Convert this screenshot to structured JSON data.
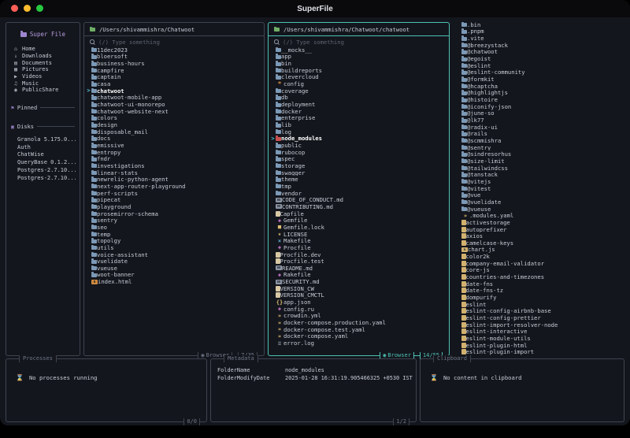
{
  "titlebar": {
    "title": "SuperFile"
  },
  "sidebar": {
    "app_title": "Super File",
    "nav": [
      {
        "label": "Home",
        "icon": "home"
      },
      {
        "label": "Downloads",
        "icon": "downloads"
      },
      {
        "label": "Documents",
        "icon": "documents"
      },
      {
        "label": "Pictures",
        "icon": "pictures"
      },
      {
        "label": "Videos",
        "icon": "videos"
      },
      {
        "label": "Music",
        "icon": "music"
      },
      {
        "label": "PublicShare",
        "icon": "publicshare"
      }
    ],
    "pinned_label": "Pinned",
    "disks_label": "Disks",
    "disks": [
      "Granola 5.175.0...",
      "Auth",
      "ChatWise",
      "QueryBase 0.1.2...",
      "Postgres-2.7.10...",
      "Postgres-2.7.10..."
    ]
  },
  "panels": [
    {
      "path": "/Users/shivammishra/Chatwoot",
      "search_placeholder": "(/) Type something",
      "mode": "Browser",
      "count": "7/35",
      "files": [
        {
          "name": "11dec2023",
          "icon": "folder"
        },
        {
          "name": "bloersoft",
          "icon": "folder"
        },
        {
          "name": "business-hours",
          "icon": "folder"
        },
        {
          "name": "campfire",
          "icon": "folder"
        },
        {
          "name": "captain",
          "icon": "folder"
        },
        {
          "name": "casa",
          "icon": "folder"
        },
        {
          "name": "chatwoot",
          "icon": "folder",
          "sel": true
        },
        {
          "name": "chatwoot-mobile-app",
          "icon": "folder"
        },
        {
          "name": "chatwoot-ui-monorepo",
          "icon": "folder"
        },
        {
          "name": "chatwoot-website-next",
          "icon": "folder"
        },
        {
          "name": "colors",
          "icon": "folder"
        },
        {
          "name": "design",
          "icon": "folder"
        },
        {
          "name": "disposable_mail",
          "icon": "folder"
        },
        {
          "name": "docs",
          "icon": "folder"
        },
        {
          "name": "emissive",
          "icon": "folder"
        },
        {
          "name": "entropy",
          "icon": "folder"
        },
        {
          "name": "fndr",
          "icon": "folder"
        },
        {
          "name": "investigations",
          "icon": "folder"
        },
        {
          "name": "linear-stats",
          "icon": "folder"
        },
        {
          "name": "newrelic-python-agent",
          "icon": "folder"
        },
        {
          "name": "next-app-router-playground",
          "icon": "folder"
        },
        {
          "name": "perf-scripts",
          "icon": "folder"
        },
        {
          "name": "pipecat",
          "icon": "folder"
        },
        {
          "name": "playground",
          "icon": "folder"
        },
        {
          "name": "prosemirror-schema",
          "icon": "folder"
        },
        {
          "name": "sentry",
          "icon": "folder"
        },
        {
          "name": "seo",
          "icon": "folder"
        },
        {
          "name": "temp",
          "icon": "folder"
        },
        {
          "name": "topolgy",
          "icon": "folder"
        },
        {
          "name": "utils",
          "icon": "folder"
        },
        {
          "name": "voice-assistant",
          "icon": "folder"
        },
        {
          "name": "vuelidate",
          "icon": "folder"
        },
        {
          "name": "vueuse",
          "icon": "folder"
        },
        {
          "name": "woot-banner",
          "icon": "folder"
        },
        {
          "name": "index.html",
          "icon": "html"
        }
      ]
    },
    {
      "path": "/Users/shivammishra/Chatwoot/chatwoot",
      "search_placeholder": "(/) Type something",
      "mode": "Browser",
      "count": "14/55",
      "files": [
        {
          "name": "__mocks__",
          "icon": "folder"
        },
        {
          "name": "app",
          "icon": "folder"
        },
        {
          "name": "bin",
          "icon": "folder"
        },
        {
          "name": "buildreports",
          "icon": "folder"
        },
        {
          "name": "clevercloud",
          "icon": "folder"
        },
        {
          "name": "config",
          "icon": "gear"
        },
        {
          "name": "coverage",
          "icon": "folder"
        },
        {
          "name": "db",
          "icon": "folder"
        },
        {
          "name": "deployment",
          "icon": "folder"
        },
        {
          "name": "docker",
          "icon": "folder"
        },
        {
          "name": "enterprise",
          "icon": "folder"
        },
        {
          "name": "lib",
          "icon": "folder"
        },
        {
          "name": "log",
          "icon": "folder"
        },
        {
          "name": "node_modules",
          "icon": "folder-red",
          "sel": true
        },
        {
          "name": "public",
          "icon": "folder"
        },
        {
          "name": "rubocop",
          "icon": "folder"
        },
        {
          "name": "spec",
          "icon": "folder"
        },
        {
          "name": "storage",
          "icon": "folder"
        },
        {
          "name": "swagger",
          "icon": "folder"
        },
        {
          "name": "theme",
          "icon": "folder"
        },
        {
          "name": "tmp",
          "icon": "folder"
        },
        {
          "name": "vendor",
          "icon": "folder"
        },
        {
          "name": "CODE_OF_CONDUCT.md",
          "icon": "md"
        },
        {
          "name": "CONTRIBUTING.md",
          "icon": "md"
        },
        {
          "name": "Capfile",
          "icon": "file"
        },
        {
          "name": "Gemfile",
          "icon": "gem"
        },
        {
          "name": "Gemfile.lock",
          "icon": "lock"
        },
        {
          "name": "LICENSE",
          "icon": "key"
        },
        {
          "name": "Makefile",
          "icon": "make"
        },
        {
          "name": "Procfile",
          "icon": "gem"
        },
        {
          "name": "Procfile.dev",
          "icon": "file"
        },
        {
          "name": "Procfile.test",
          "icon": "file"
        },
        {
          "name": "README.md",
          "icon": "md"
        },
        {
          "name": "Rakefile",
          "icon": "gem"
        },
        {
          "name": "SECURITY.md",
          "icon": "md"
        },
        {
          "name": "VERSION_CW",
          "icon": "file"
        },
        {
          "name": "VERSION_CMCTL",
          "icon": "file"
        },
        {
          "name": "app.json",
          "icon": "json"
        },
        {
          "name": "config.ru",
          "icon": "ruby"
        },
        {
          "name": "crowdin.yml",
          "icon": "yaml"
        },
        {
          "name": "docker-compose.production.yaml",
          "icon": "yaml"
        },
        {
          "name": "docker-compose.test.yaml",
          "icon": "yaml"
        },
        {
          "name": "docker-compose.yaml",
          "icon": "yaml"
        },
        {
          "name": "error.log",
          "icon": "log"
        }
      ]
    }
  ],
  "preview": {
    "files": [
      {
        "name": ".bin",
        "icon": "folder"
      },
      {
        "name": ".pnpm",
        "icon": "folder"
      },
      {
        "name": ".vite",
        "icon": "folder"
      },
      {
        "name": "@breezystack",
        "icon": "folder"
      },
      {
        "name": "@chatwoot",
        "icon": "folder"
      },
      {
        "name": "@egoist",
        "icon": "folder"
      },
      {
        "name": "@eslint",
        "icon": "folder"
      },
      {
        "name": "@eslint-community",
        "icon": "folder"
      },
      {
        "name": "@formkit",
        "icon": "folder"
      },
      {
        "name": "@hcaptcha",
        "icon": "folder"
      },
      {
        "name": "@highlightjs",
        "icon": "folder"
      },
      {
        "name": "@histoire",
        "icon": "folder"
      },
      {
        "name": "@iconify-json",
        "icon": "folder"
      },
      {
        "name": "@june-so",
        "icon": "folder"
      },
      {
        "name": "@lk77",
        "icon": "folder"
      },
      {
        "name": "@radix-ui",
        "icon": "folder"
      },
      {
        "name": "@rails",
        "icon": "folder"
      },
      {
        "name": "@scmmishra",
        "icon": "folder"
      },
      {
        "name": "@sentry",
        "icon": "folder"
      },
      {
        "name": "@sindresorhus",
        "icon": "folder"
      },
      {
        "name": "@size-limit",
        "icon": "folder"
      },
      {
        "name": "@tailwindcss",
        "icon": "folder"
      },
      {
        "name": "@tanstack",
        "icon": "folder"
      },
      {
        "name": "@vitejs",
        "icon": "folder"
      },
      {
        "name": "@vitest",
        "icon": "folder"
      },
      {
        "name": "@vue",
        "icon": "folder"
      },
      {
        "name": "@vuelidate",
        "icon": "folder"
      },
      {
        "name": "@vueuse",
        "icon": "folder"
      },
      {
        "name": ".modules.yaml",
        "icon": "yaml"
      },
      {
        "name": "activestorage",
        "icon": "npm"
      },
      {
        "name": "autoprefixer",
        "icon": "npm"
      },
      {
        "name": "axios",
        "icon": "npm"
      },
      {
        "name": "camelcase-keys",
        "icon": "npm"
      },
      {
        "name": "chart.js",
        "icon": "js"
      },
      {
        "name": "color2k",
        "icon": "npm"
      },
      {
        "name": "company-email-validator",
        "icon": "npm"
      },
      {
        "name": "core-js",
        "icon": "npm"
      },
      {
        "name": "countries-and-timezones",
        "icon": "npm"
      },
      {
        "name": "date-fns",
        "icon": "npm"
      },
      {
        "name": "date-fns-tz",
        "icon": "npm"
      },
      {
        "name": "dompurify",
        "icon": "npm"
      },
      {
        "name": "eslint",
        "icon": "npm"
      },
      {
        "name": "eslint-config-airbnb-base",
        "icon": "npm"
      },
      {
        "name": "eslint-config-prettier",
        "icon": "npm"
      },
      {
        "name": "eslint-import-resolver-node",
        "icon": "npm"
      },
      {
        "name": "eslint-interactive",
        "icon": "npm"
      },
      {
        "name": "eslint-module-utils",
        "icon": "npm"
      },
      {
        "name": "eslint-plugin-html",
        "icon": "npm"
      },
      {
        "name": "eslint-plugin-import",
        "icon": "npm"
      }
    ]
  },
  "processes": {
    "title": "Processes",
    "empty": "No processes running",
    "count": "0/0"
  },
  "metadata": {
    "title": "Metadata",
    "rows": [
      {
        "key": "FolderName",
        "value": "node_modules"
      },
      {
        "key": "FolderModifyDate",
        "value": "2025-01-28 16:31:19.905466325 +0530 IST"
      }
    ],
    "count": "1/2"
  },
  "clipboard": {
    "title": "Clipboard",
    "empty": "No content in clipboard"
  }
}
